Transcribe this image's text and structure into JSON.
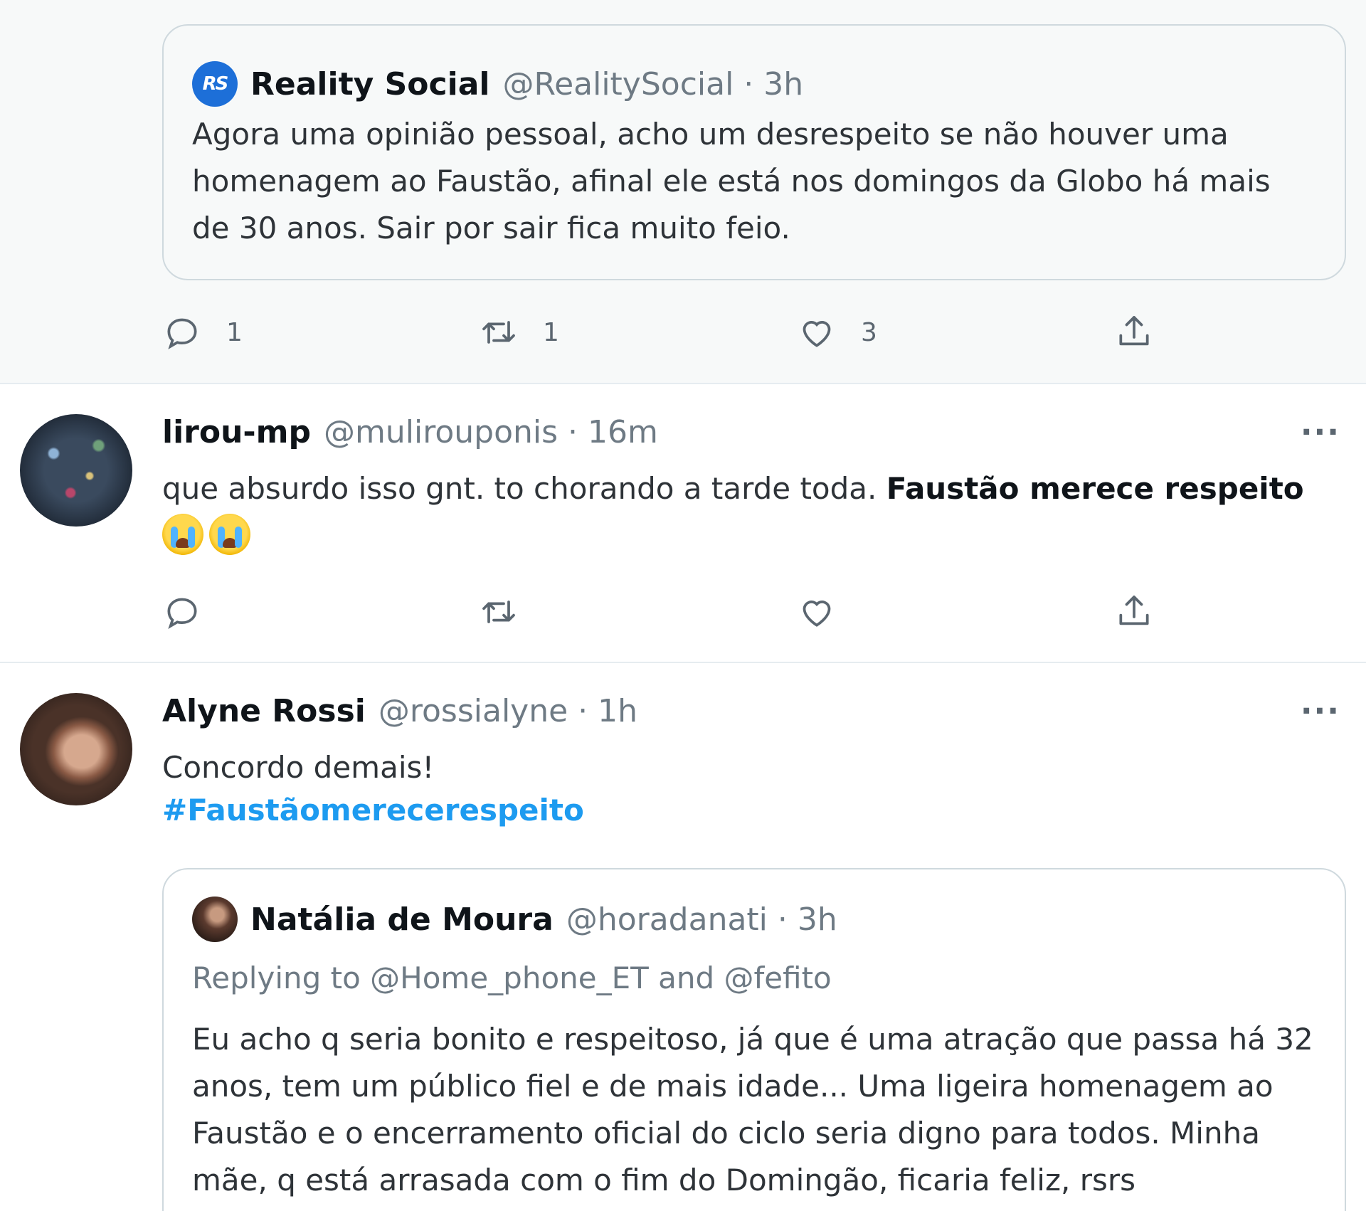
{
  "quoted_tweet_1": {
    "avatar_text": "RS",
    "name": "Reality Social",
    "handle_time": "@RealitySocial · 3h",
    "text": "Agora uma opinião pessoal, acho um desrespeito se não houver uma homenagem ao Faustão, afinal ele está nos domingos da Globo há mais de 30 anos. Sair por sair fica muito feio."
  },
  "tweet_1_actions": {
    "reply_count": "1",
    "retweet_count": "1",
    "like_count": "3"
  },
  "tweet_2": {
    "name": "lirou-mp",
    "handle_time": "@mulirouponis · 16m",
    "text_plain": "que absurdo isso gnt. to chorando a tarde toda. ",
    "text_bold": "Faustão merece respeito",
    "emojis": [
      "loudly-crying-face",
      "loudly-crying-face"
    ],
    "more": "···"
  },
  "tweet_3": {
    "name": "Alyne Rossi",
    "handle_time": "@rossialyne · 1h",
    "text": "Concordo demais!",
    "hashtag": "#Faustãomerecerespeito",
    "more": "···"
  },
  "quoted_tweet_2": {
    "name": "Natália de Moura",
    "handle_time": "@horadanati · 3h",
    "replying_to": "Replying to @Home_phone_ET and @fefito",
    "text": "Eu acho q seria bonito e respeitoso, já que é uma atração que passa há 32 anos, tem um público fiel e de mais idade... Uma ligeira homenagem ao Faustão e o encerramento oficial do ciclo seria digno para todos. Minha mãe, q está arrasada com o fim do Domingão, ficaria feliz, rsrs"
  },
  "colors": {
    "link_blue": "#1d9bf0",
    "icon_gray": "#5b6670",
    "border": "#cfd9de"
  }
}
